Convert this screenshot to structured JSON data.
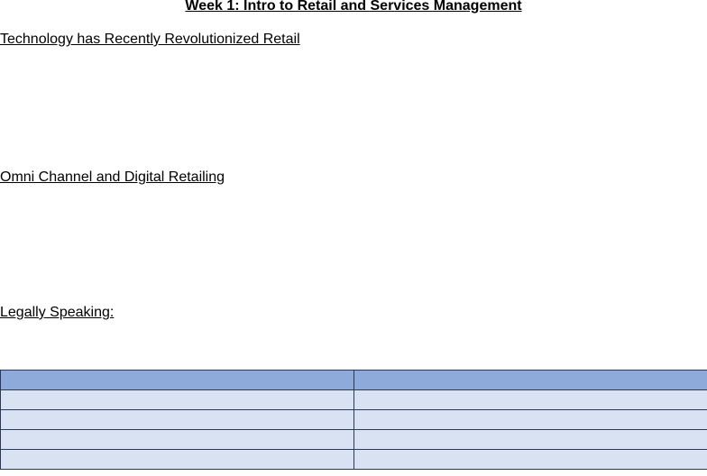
{
  "document": {
    "title": "Week 1: Intro to Retail and Services Management",
    "sections": [
      {
        "heading": "Technology has Recently Revolutionized Retail"
      },
      {
        "heading": "Omni Channel and Digital Retailing"
      },
      {
        "heading": "Legally Speaking:"
      }
    ]
  },
  "table": {
    "header": [
      "",
      ""
    ],
    "rows": [
      [
        "",
        ""
      ],
      [
        "",
        ""
      ],
      [
        "",
        ""
      ],
      [
        "",
        ""
      ]
    ],
    "colors": {
      "header_fill": "#8eaadb",
      "row_fill": "#d9e2f3",
      "border": "#2a3a55"
    }
  }
}
